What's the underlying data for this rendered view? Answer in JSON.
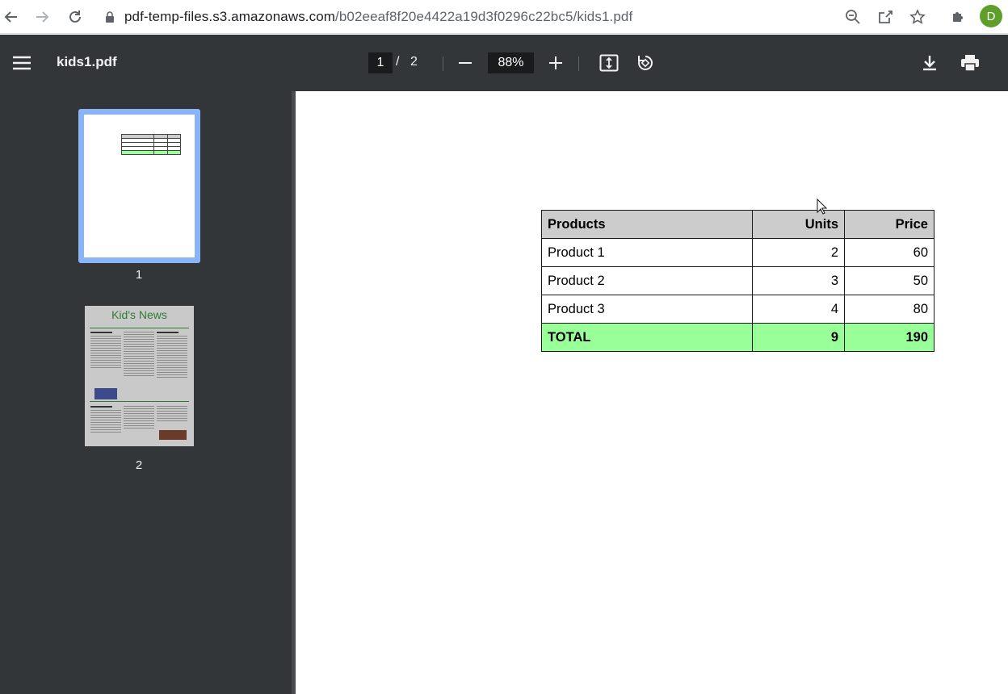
{
  "browser": {
    "url_host": "pdf-temp-files.s3.amazonaws.com",
    "url_path": "/b02eeaf8f20e4422a19d3f0296c22bc5/kids1.pdf",
    "avatar_letter": "D",
    "avatar_color": "#5f9e2a"
  },
  "viewer": {
    "file_name": "kids1.pdf",
    "current_page": "1",
    "page_separator": "/",
    "total_pages": "2",
    "zoom": "88%"
  },
  "sidebar": {
    "thumbnails": [
      {
        "label": "1",
        "selected": true
      },
      {
        "label": "2",
        "selected": false,
        "title": "Kid's News"
      }
    ]
  },
  "document": {
    "table": {
      "headers": [
        "Products",
        "Units",
        "Price"
      ],
      "rows": [
        [
          "Product 1",
          "2",
          "60"
        ],
        [
          "Product 2",
          "3",
          "50"
        ],
        [
          "Product 3",
          "4",
          "80"
        ]
      ],
      "total": [
        "TOTAL",
        "9",
        "190"
      ],
      "header_color": "#cccccc",
      "total_color": "#99ff99"
    }
  },
  "colors": {
    "toolbar_bg": "#323639",
    "thumb_selected": "#8ab4f8"
  }
}
